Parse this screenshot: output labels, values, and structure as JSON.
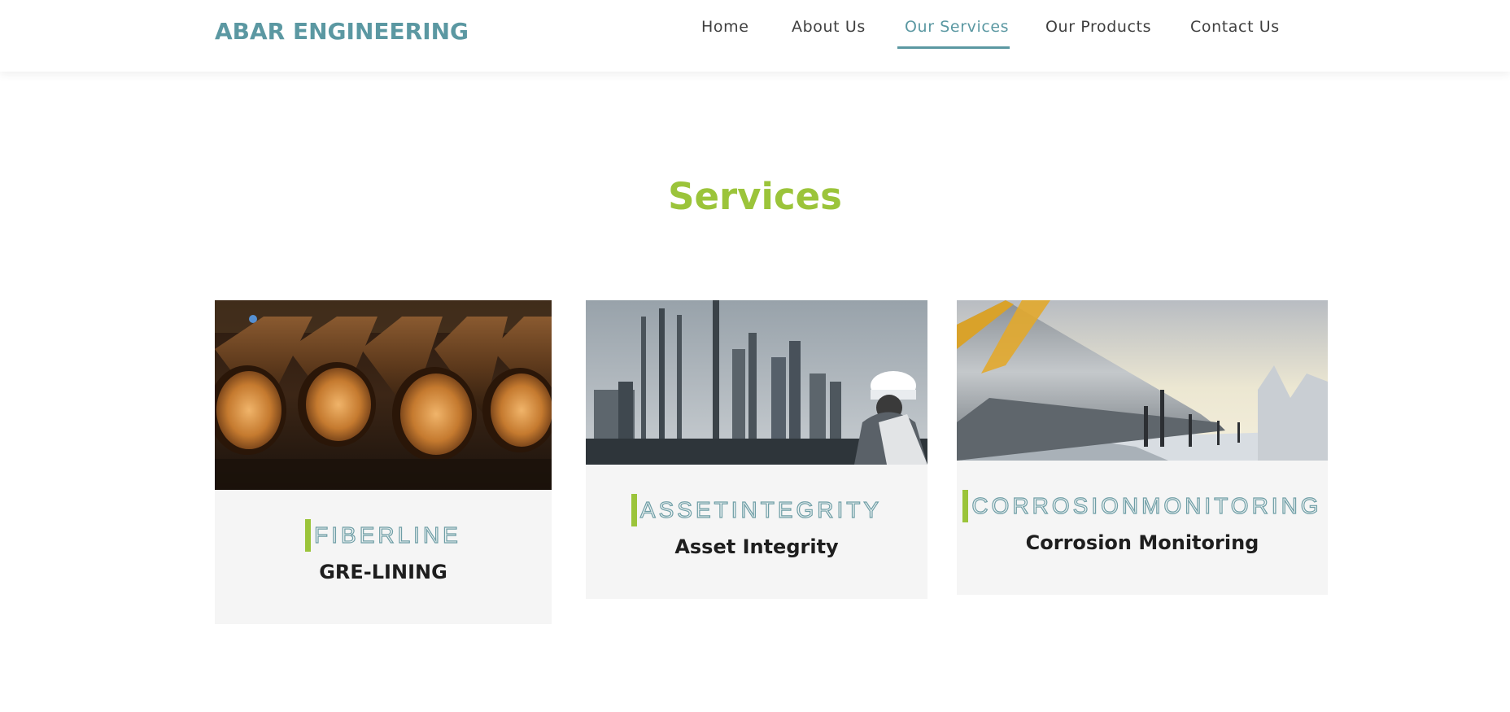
{
  "header": {
    "logo": "ABAR ENGINEERING",
    "nav": [
      {
        "label": "Home"
      },
      {
        "label": "About Us"
      },
      {
        "label": "Our Services"
      },
      {
        "label": "Our Products"
      },
      {
        "label": "Contact Us"
      }
    ],
    "active_nav": "Our Services"
  },
  "main": {
    "title": "Services",
    "cards": [
      {
        "tag": "FIBERLINE",
        "title": "GRE-LINING",
        "image": "stacked-steel-pipes-photo"
      },
      {
        "tag": "ASSETINTEGRITY",
        "title": "Asset Integrity",
        "image": "refinery-engineer-photo"
      },
      {
        "tag": "CORROSIONMONITORING",
        "title": "Corrosion Monitoring",
        "image": "snowy-pipeline-photo"
      }
    ]
  },
  "colors": {
    "brand": "#5b98a2",
    "accent": "#9bc43a",
    "card_bg": "#f5f5f5",
    "text_dark": "#1e1e1e"
  }
}
